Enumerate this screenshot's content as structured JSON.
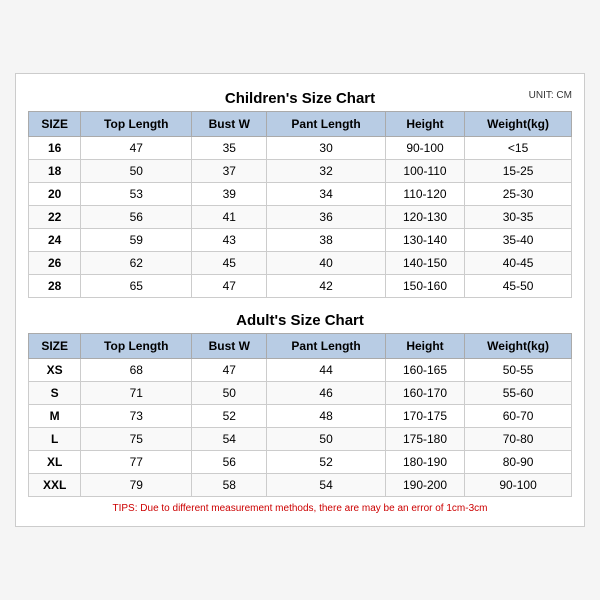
{
  "children_title": "Children's Size Chart",
  "adults_title": "Adult's Size Chart",
  "unit_label": "UNIT: CM",
  "headers": [
    "SIZE",
    "Top Length",
    "Bust W",
    "Pant Length",
    "Height",
    "Weight(kg)"
  ],
  "children_rows": [
    [
      "16",
      "47",
      "35",
      "30",
      "90-100",
      "<15"
    ],
    [
      "18",
      "50",
      "37",
      "32",
      "100-110",
      "15-25"
    ],
    [
      "20",
      "53",
      "39",
      "34",
      "110-120",
      "25-30"
    ],
    [
      "22",
      "56",
      "41",
      "36",
      "120-130",
      "30-35"
    ],
    [
      "24",
      "59",
      "43",
      "38",
      "130-140",
      "35-40"
    ],
    [
      "26",
      "62",
      "45",
      "40",
      "140-150",
      "40-45"
    ],
    [
      "28",
      "65",
      "47",
      "42",
      "150-160",
      "45-50"
    ]
  ],
  "adults_rows": [
    [
      "XS",
      "68",
      "47",
      "44",
      "160-165",
      "50-55"
    ],
    [
      "S",
      "71",
      "50",
      "46",
      "160-170",
      "55-60"
    ],
    [
      "M",
      "73",
      "52",
      "48",
      "170-175",
      "60-70"
    ],
    [
      "L",
      "75",
      "54",
      "50",
      "175-180",
      "70-80"
    ],
    [
      "XL",
      "77",
      "56",
      "52",
      "180-190",
      "80-90"
    ],
    [
      "XXL",
      "79",
      "58",
      "54",
      "190-200",
      "90-100"
    ]
  ],
  "tips": "TIPS: Due to different measurement methods, there are may be an error of 1cm-3cm"
}
